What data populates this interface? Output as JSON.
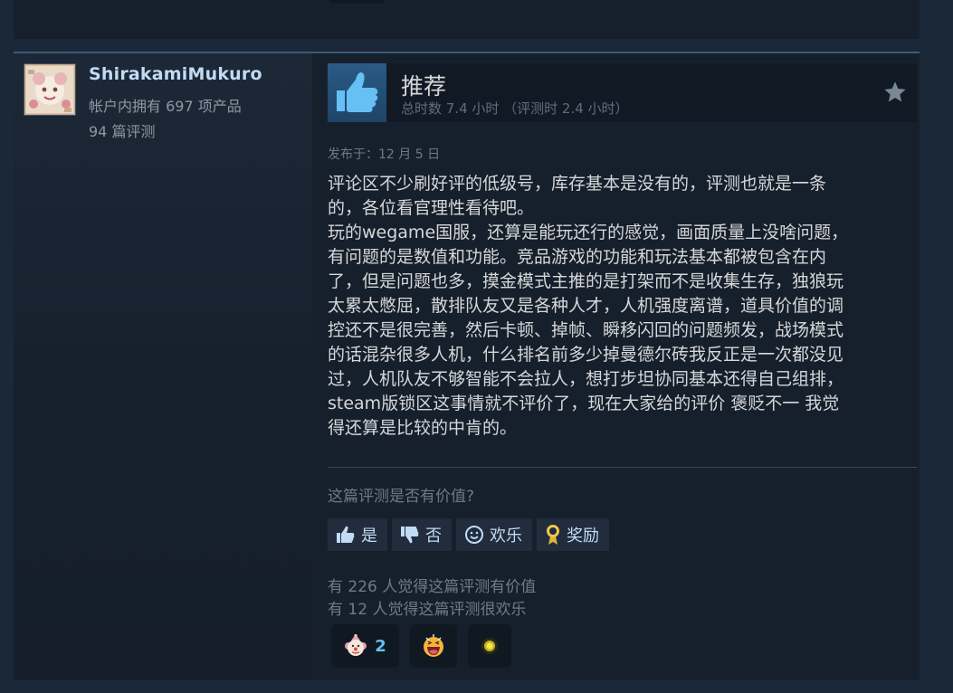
{
  "reviewer": {
    "name": "ShirakamiMukuro",
    "products_owned": "帐户内拥有 697 项产品",
    "review_count": "94 篇评测"
  },
  "review": {
    "recommendation": "推荐",
    "hours": "总时数 7.4 小时 （评测时 2.4 小时）",
    "posted": "发布于：12 月 5 日",
    "body": "评论区不少刷好评的低级号，库存基本是没有的，评测也就是一条\n的，各位看官理性看待吧。\n玩的wegame国服，还算是能玩还行的感觉，画面质量上没啥问题，\n有问题的是数值和功能。竞品游戏的功能和玩法基本都被包含在内\n了，但是问题也多，摸金模式主推的是打架而不是收集生存，独狼玩\n太累太憋屈，散排队友又是各种人才，人机强度离谱，道具价值的调\n控还不是很完善，然后卡顿、掉帧、瞬移闪回的问题频发，战场模式\n的话混杂很多人机，什么排名前多少掉曼德尔砖我反正是一次都没见\n过，人机队友不够智能不会拉人，想打步坦协同基本还得自己组排，\nsteam版锁区这事情就不评价了，现在大家给的评价 褒贬不一 我觉\n得还算是比较的中肯的。"
  },
  "feedback": {
    "question": "这篇评测是否有价值?",
    "yes_label": "是",
    "no_label": "否",
    "funny_label": "欢乐",
    "award_label": "奖励",
    "helpful_count": "有 226 人觉得这篇评测有价值",
    "funny_count": "有 12 人觉得这篇评测很欢乐"
  },
  "awards": [
    {
      "icon": "clown-face-award-icon",
      "count": "2"
    },
    {
      "icon": "laughing-face-award-icon",
      "count": ""
    },
    {
      "icon": "glowing-orb-award-icon",
      "count": ""
    }
  ],
  "colors": {
    "background": "#1b2838",
    "card": "#16202d",
    "link_blue": "#c1dbf4",
    "muted": "#6d7a88",
    "thumb_blue": "#2a5a86"
  }
}
